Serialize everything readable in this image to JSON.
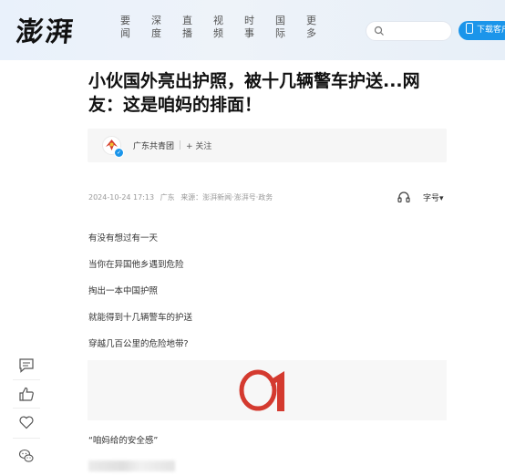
{
  "header": {
    "logo": "澎湃",
    "nav": [
      {
        "label": [
          "要",
          "闻"
        ]
      },
      {
        "label": [
          "深",
          "度"
        ]
      },
      {
        "label": [
          "直",
          "播"
        ]
      },
      {
        "label": [
          "视",
          "频"
        ]
      },
      {
        "label": [
          "时",
          "事"
        ]
      },
      {
        "label": [
          "国",
          "际"
        ]
      },
      {
        "label": [
          "更",
          "多"
        ]
      }
    ],
    "search_placeholder": "",
    "download_label": "下载客户端"
  },
  "article": {
    "title": "小伙国外亮出护照，被十几辆警车护送...网友：这是咱妈的排面！",
    "author": {
      "name": "广东共青团",
      "follow_label": "+ 关注"
    },
    "meta": {
      "datetime": "2024-10-24 17:13",
      "location": "广东",
      "source": "来源：澎湃新闻·澎湃号·政务"
    },
    "font_size_label": "字号▾",
    "paragraphs": [
      "有没有想过有一天",
      "当你在异国他乡遇到危险",
      "掏出一本中国护照",
      "就能得到十几辆警车的护送",
      "穿越几百公里的危险地带?"
    ],
    "image_text": "01",
    "caption": "“咱妈给的安全感”"
  },
  "toolbar": {
    "icons": [
      "comment-icon",
      "like-icon",
      "favorite-heart-icon",
      "wechat-share-icon"
    ]
  },
  "colors": {
    "accent": "#1b95ea",
    "image_red": "#d43a2f"
  }
}
